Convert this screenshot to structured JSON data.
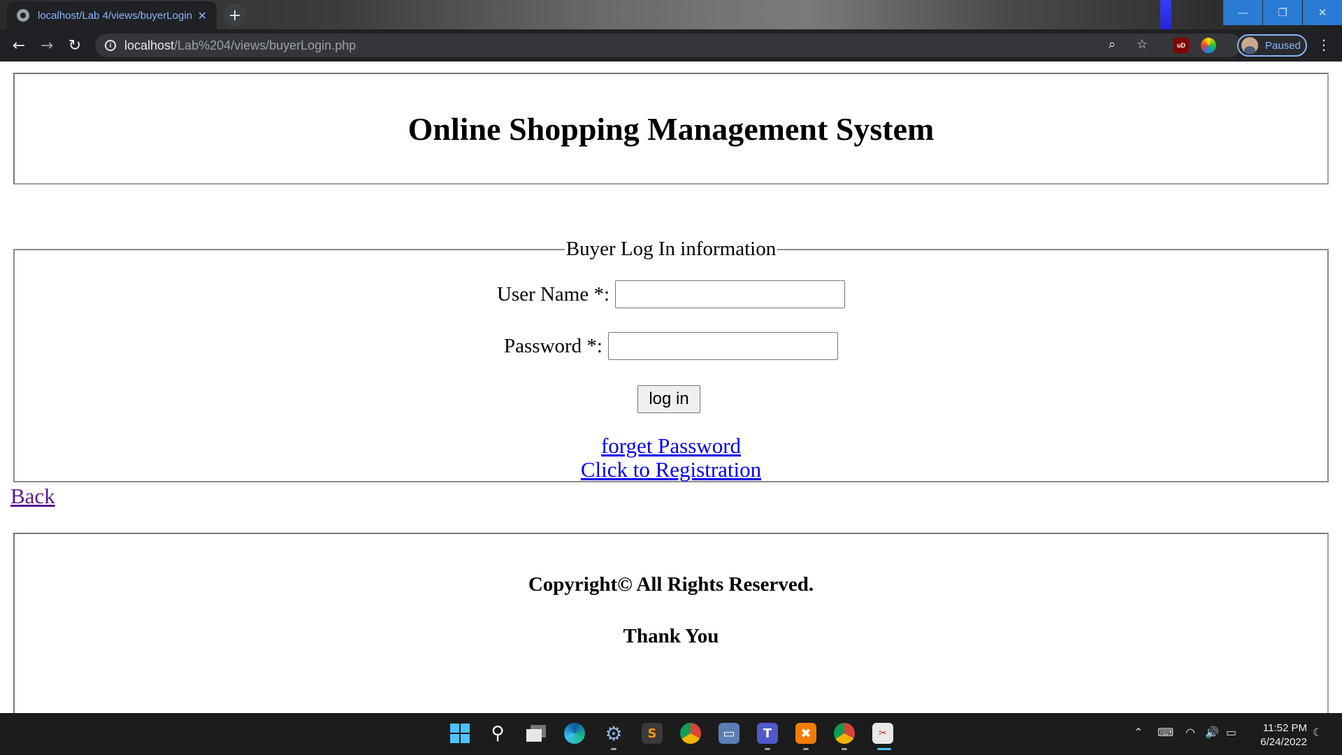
{
  "browser": {
    "tab_title": "localhost/Lab 4/views/buyerLogin",
    "tab_close": "✕",
    "new_tab": "+",
    "url_host": "localhost",
    "url_path": "/Lab%204/views/buyerLogin.php",
    "profile_status": "Paused",
    "window_controls": [
      "—",
      "❐",
      "✕"
    ],
    "extension_ublock": "uD"
  },
  "page": {
    "title": "Online Shopping Management System",
    "form": {
      "legend": "Buyer Log In information",
      "username_label": "User Name *:",
      "username_value": "",
      "password_label": "Password *:",
      "password_value": "",
      "submit_label": "log in",
      "forget_link": "forget Password",
      "register_link": "Click to Registration"
    },
    "back_link": "Back",
    "footer": {
      "copyright": "Copyright© All Rights Reserved.",
      "thanks": "Thank You"
    }
  },
  "taskbar": {
    "time": "11:52 PM",
    "date": "6/24/2022",
    "apps": [
      "start-icon",
      "search-icon",
      "task-view-icon",
      "edge-icon",
      "settings-icon",
      "sublime-icon",
      "chrome-icon",
      "remote-desktop-icon",
      "teams-icon",
      "xampp-icon",
      "chrome-icon",
      "snipping-tool-icon"
    ]
  },
  "colors": {
    "link": "#0000ee",
    "visited_link": "#551a8b",
    "chrome_dark": "#202124",
    "accent_blue": "#8ab4f8"
  }
}
